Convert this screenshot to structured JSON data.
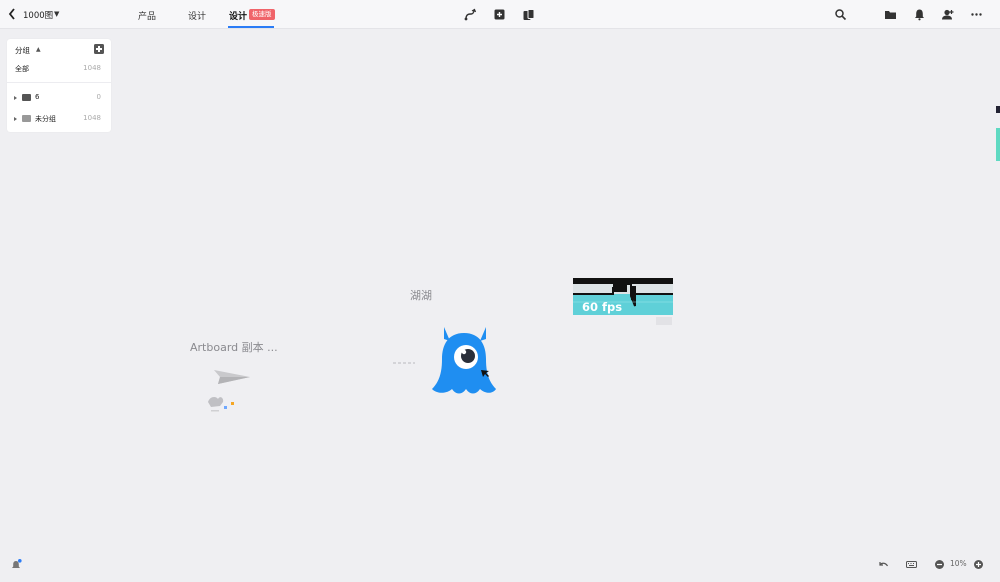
{
  "header": {
    "project_name": "1000图",
    "tabs": [
      {
        "label": "产品"
      },
      {
        "label": "设计"
      },
      {
        "label": "设计",
        "badge": "极速版"
      }
    ]
  },
  "groups_panel": {
    "title": "分组",
    "all": {
      "label": "全部",
      "count": "1048"
    },
    "items": [
      {
        "label": "6",
        "count": "0"
      },
      {
        "label": "未分组",
        "count": "1048"
      }
    ]
  },
  "canvas": {
    "artboards": [
      {
        "label": "湖湖"
      },
      {
        "label": "Artboard 副本 ..."
      }
    ],
    "fps_overlay": "60 fps"
  },
  "footer": {
    "zoom": "10%"
  },
  "colors": {
    "accent": "#2b7cf6",
    "badge": "#f0646a",
    "mascot": "#1f8ef1",
    "fps_teal": "#5fd0d8"
  }
}
